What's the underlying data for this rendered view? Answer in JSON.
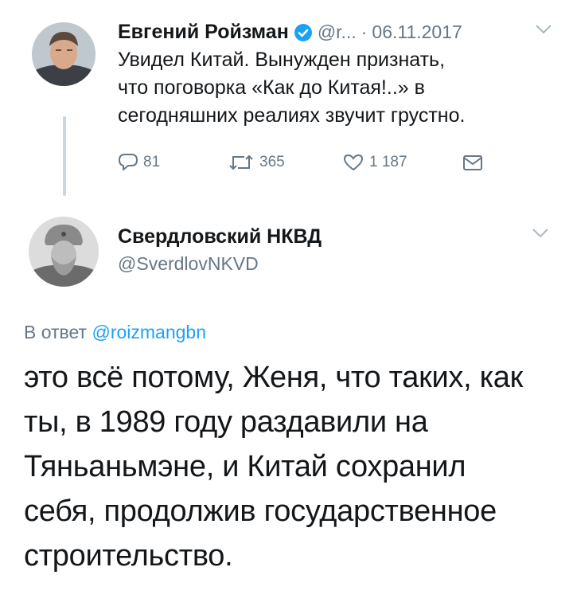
{
  "tweet": {
    "author_name": "Евгений Ройзман",
    "handle": "@r...",
    "separator": "·",
    "date": "06.11.2017",
    "text_lines": [
      "Увидел Китай. Вынужден признать,",
      "что поговорка «Как до Китая!..» в",
      "сегодняшних реалиях звучит грустно."
    ],
    "replies": "81",
    "retweets": "365",
    "likes": "1 187"
  },
  "reply": {
    "author_name": "Свердловский НКВД",
    "handle": "@SverdlovNKVD",
    "reply_prefix": "В ответ",
    "reply_handle": "@roizmangbn",
    "text_lines": [
      "это всё потому, Женя, что таких, как",
      "ты, в 1989 году раздавили на",
      "Тяньаньмэне, и Китай сохранил",
      "себя, продолжив государственное",
      "строительство."
    ]
  },
  "icons": {
    "verified": "verified-badge-icon",
    "reply": "reply-icon",
    "retweet": "retweet-icon",
    "like": "heart-icon",
    "dm": "envelope-icon",
    "more": "chevron-down-icon"
  },
  "colors": {
    "verified": "#1da1f2",
    "link": "#1da1f2",
    "muted": "#657786",
    "thread_line": "#ccd6dd"
  }
}
